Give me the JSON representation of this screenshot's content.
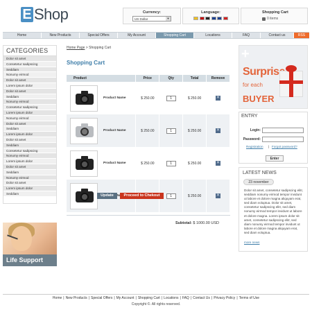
{
  "brand": {
    "letter": "E",
    "word": "Shop"
  },
  "currency": {
    "title": "Currency:",
    "selected": "US Dollar"
  },
  "language": {
    "title": "Language:",
    "flags": [
      "#f0c020",
      "#c00000",
      "#222222",
      "#1b3f8f",
      "#1b3f8f",
      "#d42020"
    ]
  },
  "cart_box": {
    "title": "Shopping Cart",
    "items": "0 items"
  },
  "nav": {
    "items": [
      "Home",
      "New Products",
      "Special Offers",
      "My Account",
      "Shopping Cart",
      "Locations",
      "FAQ",
      "Contact us",
      "RSS"
    ],
    "active_index": 4
  },
  "categories": {
    "title": "CATEGORIES",
    "items": [
      "Dolor sit amet",
      "Consetetur sadipscing",
      "Seddiam",
      "Nonumy eirmod",
      "Dolor sit amet",
      "Lorem ipsum dolor",
      "Dolor sit amet",
      "Seddiam",
      "Nonumy eirmod",
      "Consetetur sadipscing",
      "Lorem ipsum dolor",
      "Nonumy eirmod",
      "Dolor sit amet",
      "Seddiam",
      "Lorem ipsum dolor",
      "Dolor sit amet",
      "Seddiam",
      "Consetetur sadipscing",
      "Nonumy eirmod",
      "Lorem ipsum dolor",
      "Dolor sit amet",
      "Seddiam",
      "Nonumy eirmod",
      "Dolor sit amet",
      "Lorem ipsum dolor",
      "Seddiam"
    ]
  },
  "support_label": "Life Support",
  "breadcrumb": {
    "home": "Home Page",
    "sep": ">",
    "current": "Shopping Cart"
  },
  "page_title": "Shopping Cart",
  "table": {
    "headers": [
      "Product",
      "Price",
      "Qty",
      "Total",
      "Remove"
    ],
    "rows": [
      {
        "name": "Product Name",
        "price": "$ 250.00",
        "qty": "1",
        "total": "$ 250.00",
        "camera": "black"
      },
      {
        "name": "Product Name",
        "price": "$ 250.00",
        "qty": "1",
        "total": "$ 250.00",
        "camera": "silver"
      },
      {
        "name": "Product Name",
        "price": "$ 250.00",
        "qty": "1",
        "total": "$ 250.00",
        "camera": "black"
      },
      {
        "name": "Product Name",
        "price": "$ 250.00",
        "qty": "1",
        "total": "$ 250.00",
        "camera": "black"
      }
    ]
  },
  "subtotal": {
    "label": "Subtotal:",
    "value": "$ 1000.00 USD"
  },
  "buttons": {
    "update": "Update",
    "checkout": "Proceed to Chekout"
  },
  "promo": {
    "plus": "+",
    "line1": "Surprise",
    "line2": "for each",
    "line3": "BUYER"
  },
  "entry": {
    "title": "ENTRY",
    "login_label": "Login:",
    "password_label": "Password:",
    "registration": "Registration",
    "forgot": "Forgot password?",
    "enter": "Enter"
  },
  "news": {
    "title": "LATEST NEWS",
    "date": "23 november",
    "body": "Dolor sit amet, consetetur sadipscing elitr, seddiam nonumy eirmod tempor invidunt ut labore et dolore magna aliquyam erat, sed diam voluptua. Dolor sit amet, consetetur sadipscing elitr, sed diam nonumy eirmod tempor invidunt ut labore et dolore magna. Lorem ipsum dolor sit amet, consetetur sadipscing elitr, sed diam nonumy eirmod tempor invidunt ut labore et dolore magna aliquyam erat, sed diam voluptua.",
    "more": "more news"
  },
  "footer": {
    "links": [
      "Home",
      "New Products",
      "Special Offers",
      "My Account",
      "Shopping Cart",
      "Locations",
      "FAQ",
      "Contact Us",
      "Privacy Policy",
      "Terms of Use"
    ],
    "separator": "|",
    "copyright": "Copyright ©. All rights reserved."
  }
}
